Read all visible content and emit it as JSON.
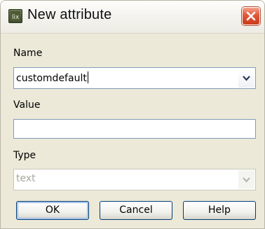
{
  "window": {
    "title": "New attribute"
  },
  "fields": {
    "name": {
      "label": "Name",
      "value": "customdefault"
    },
    "value": {
      "label": "Value",
      "value": ""
    },
    "type": {
      "label": "Type",
      "value": "text"
    }
  },
  "buttons": {
    "ok": "OK",
    "cancel": "Cancel",
    "help": "Help"
  },
  "colors": {
    "field_border": "#7f9db9",
    "dialog_bg": "#ece9d8",
    "close_red": "#e0583a"
  }
}
